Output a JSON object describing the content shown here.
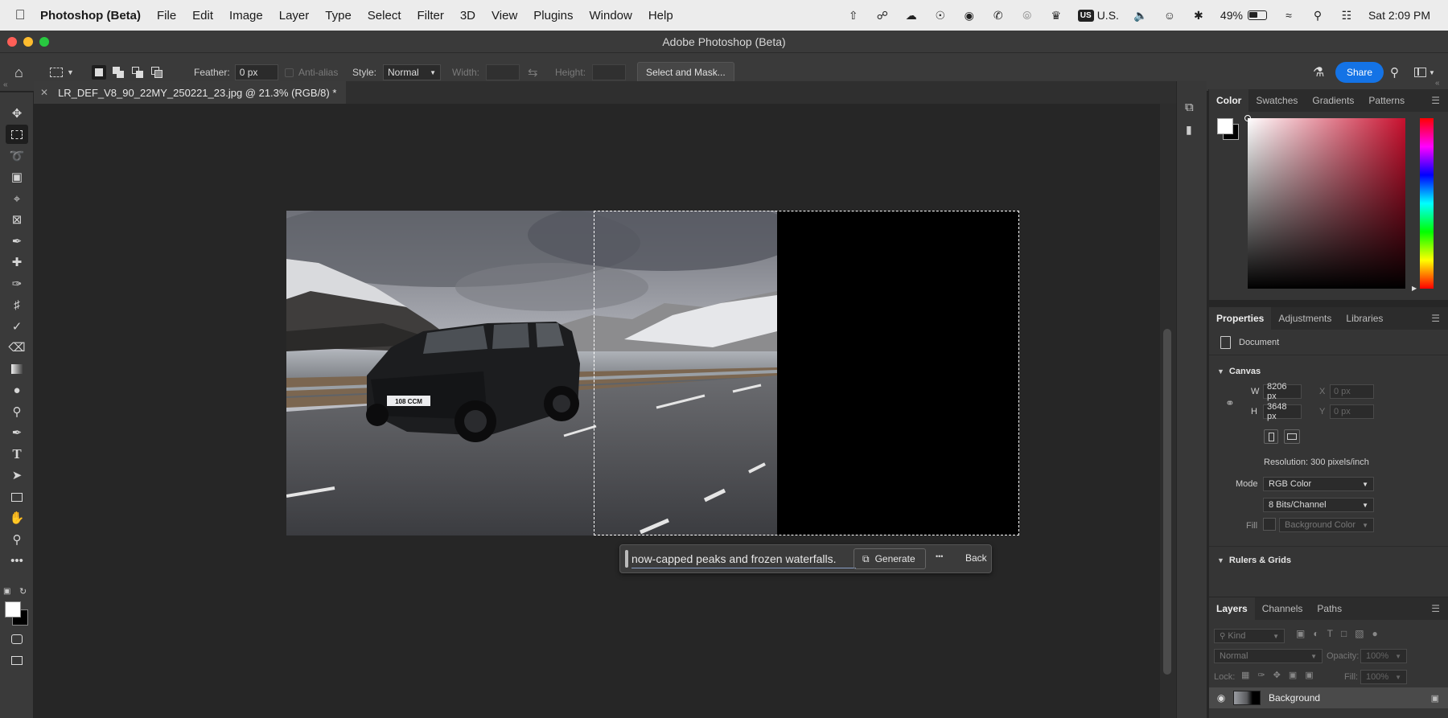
{
  "menubar": {
    "app_name": "Photoshop (Beta)",
    "items": [
      "File",
      "Edit",
      "Image",
      "Layer",
      "Type",
      "Select",
      "Filter",
      "3D",
      "View",
      "Plugins",
      "Window",
      "Help"
    ],
    "input_source_badge": "US",
    "input_source": "U.S.",
    "battery": "49%",
    "clock": "Sat  2:09 PM"
  },
  "window": {
    "title": "Adobe Photoshop (Beta)"
  },
  "options": {
    "feather_label": "Feather:",
    "feather_value": "0 px",
    "anti_alias": "Anti-alias",
    "style_label": "Style:",
    "style_value": "Normal",
    "width_label": "Width:",
    "height_label": "Height:",
    "select_mask": "Select and Mask...",
    "share": "Share"
  },
  "document": {
    "tab_title": "LR_DEF_V8_90_22MY_250221_23.jpg @ 21.3% (RGB/8) *"
  },
  "photo": {
    "plate": "108 CCM"
  },
  "generative": {
    "prompt": "now-capped peaks and frozen waterfalls.",
    "generate": "Generate",
    "more": "•••",
    "back": "Back"
  },
  "color_panel": {
    "tabs": [
      "Color",
      "Swatches",
      "Gradients",
      "Patterns"
    ],
    "hue_color": "#c8102e"
  },
  "properties_panel": {
    "tabs": [
      "Properties",
      "Adjustments",
      "Libraries"
    ],
    "document_label": "Document",
    "canvas_section": "Canvas",
    "w_label": "W",
    "w_value": "8206 px",
    "h_label": "H",
    "h_value": "3648 px",
    "x_label": "X",
    "x_value": "0 px",
    "y_label": "Y",
    "y_value": "0 px",
    "resolution": "Resolution: 300 pixels/inch",
    "mode_label": "Mode",
    "mode_value": "RGB Color",
    "bits_value": "8 Bits/Channel",
    "fill_label": "Fill",
    "fill_value": "Background Color",
    "rulers_section": "Rulers & Grids"
  },
  "layers_panel": {
    "tabs": [
      "Layers",
      "Channels",
      "Paths"
    ],
    "kind_placeholder": "Kind",
    "blend_mode": "Normal",
    "opacity_label": "Opacity:",
    "opacity_value": "100%",
    "lock_label": "Lock:",
    "fill_label": "Fill:",
    "fill_value": "100%",
    "layer_name": "Background"
  }
}
